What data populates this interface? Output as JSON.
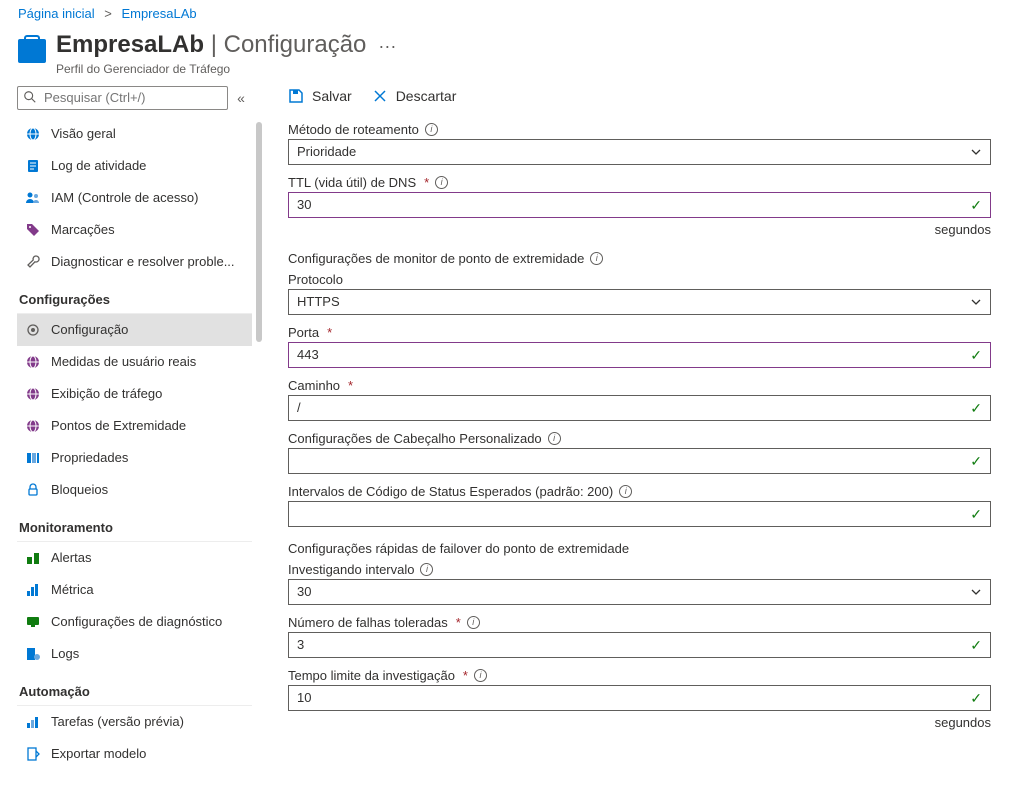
{
  "breadcrumb": {
    "home": "Página inicial",
    "current": "EmpresaLAb"
  },
  "header": {
    "name": "EmpresaLAb",
    "section": "Configuração",
    "subtitle": "Perfil do Gerenciador de Tráfego"
  },
  "search": {
    "placeholder": "Pesquisar (Ctrl+/)"
  },
  "sidebar": {
    "top": [
      {
        "label": "Visão geral"
      },
      {
        "label": "Log de atividade"
      },
      {
        "label": "IAM (Controle de acesso)"
      },
      {
        "label": "Marcações"
      },
      {
        "label": "Diagnosticar e resolver proble..."
      }
    ],
    "group1": {
      "title": "Configurações",
      "items": [
        {
          "label": "Configuração"
        },
        {
          "label": "Medidas de usuário reais"
        },
        {
          "label": "Exibição de tráfego"
        },
        {
          "label": "Pontos de Extremidade"
        },
        {
          "label": "Propriedades"
        },
        {
          "label": "Bloqueios"
        }
      ]
    },
    "group2": {
      "title": "Monitoramento",
      "items": [
        {
          "label": "Alertas"
        },
        {
          "label": "Métrica"
        },
        {
          "label": "Configurações de diagnóstico"
        },
        {
          "label": "Logs"
        }
      ]
    },
    "group3": {
      "title": "Automação",
      "items": [
        {
          "label": "Tarefas (versão prévia)"
        },
        {
          "label": "Exportar modelo"
        }
      ]
    }
  },
  "toolbar": {
    "save": "Salvar",
    "discard": "Descartar"
  },
  "form": {
    "routing": {
      "label": "Método de roteamento",
      "value": "Prioridade"
    },
    "ttl": {
      "label": "TTL (vida útil) de DNS",
      "value": "30",
      "unit": "segundos"
    },
    "monitor_section": "Configurações de monitor de ponto de extremidade",
    "protocol": {
      "label": "Protocolo",
      "value": "HTTPS"
    },
    "port": {
      "label": "Porta",
      "value": "443"
    },
    "path": {
      "label": "Caminho",
      "value": "/"
    },
    "headers": {
      "label": "Configurações de Cabeçalho Personalizado",
      "value": ""
    },
    "status": {
      "label": "Intervalos de Código de Status Esperados (padrão: 200)",
      "value": ""
    },
    "failover_section": "Configurações rápidas de failover do ponto de extremidade",
    "probing": {
      "label": "Investigando intervalo",
      "value": "30"
    },
    "failures": {
      "label": "Número de falhas toleradas",
      "value": "3"
    },
    "timeout": {
      "label": "Tempo limite da investigação",
      "value": "10",
      "unit": "segundos"
    }
  }
}
